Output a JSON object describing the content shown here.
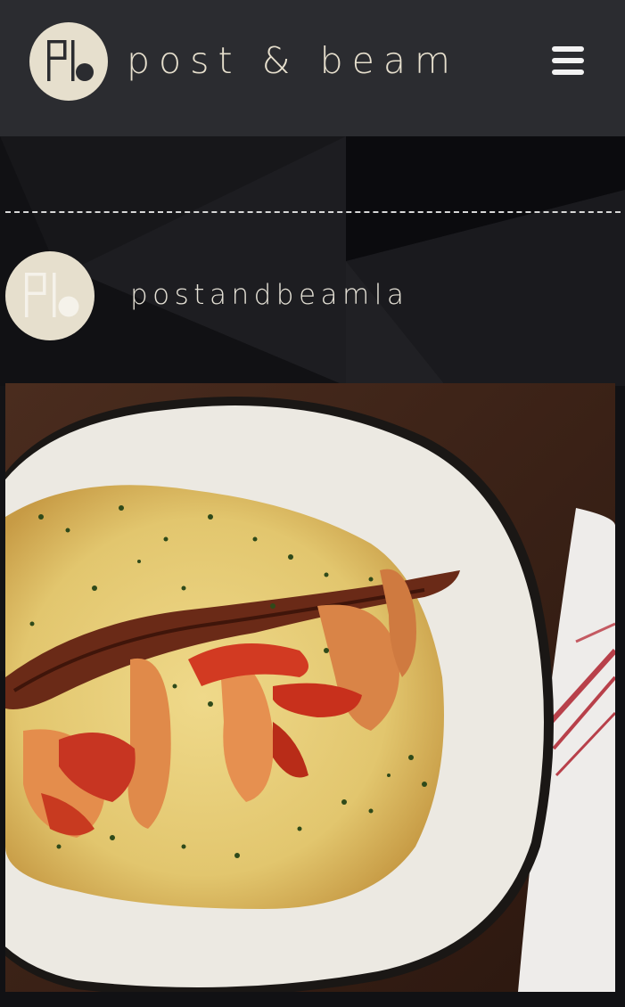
{
  "header": {
    "brand_name": "post & beam",
    "logo_icon": "pb-logo-icon",
    "menu_icon": "hamburger-menu-icon"
  },
  "instagram": {
    "avatar_icon": "pb-logo-icon",
    "username": "postandbeamla",
    "post_image": "shrimp-and-grits-plate"
  },
  "colors": {
    "header_bg": "#2b2c30",
    "brand_cream": "#e6dfcd",
    "page_bg": "#111114"
  }
}
